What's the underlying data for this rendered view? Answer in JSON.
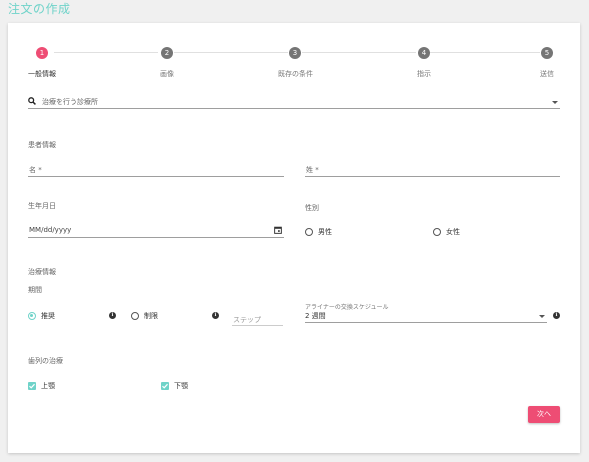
{
  "page": {
    "title": "注文の作成"
  },
  "stepper": {
    "steps": [
      {
        "number": "1",
        "label": "一般情報"
      },
      {
        "number": "2",
        "label": "画像"
      },
      {
        "number": "3",
        "label": "既存の条件"
      },
      {
        "number": "4",
        "label": "指示"
      },
      {
        "number": "5",
        "label": "送信"
      }
    ]
  },
  "clinic": {
    "placeholder": "治療を行う診療所"
  },
  "patient": {
    "section_label": "患者情報",
    "first_name_placeholder": "名 *",
    "last_name_placeholder": "姓 *",
    "dob_label": "生年月日",
    "dob_placeholder": "MM/dd/yyyy",
    "gender_label": "性別",
    "gender_options": [
      "男性",
      "女性"
    ]
  },
  "treatment": {
    "section_label": "治療情報",
    "period_label": "期間",
    "period_options": [
      "推奨",
      "制限"
    ],
    "step_placeholder": "ステップ",
    "aligner_label": "アライナーの交換スケジュール",
    "aligner_value": "2 週間",
    "arch_label": "歯列の治療",
    "arch_options": [
      "上顎",
      "下顎"
    ]
  },
  "actions": {
    "next_label": "次へ"
  },
  "colors": {
    "accent_teal": "#6fd3c9",
    "accent_pink": "#ee4d74"
  }
}
